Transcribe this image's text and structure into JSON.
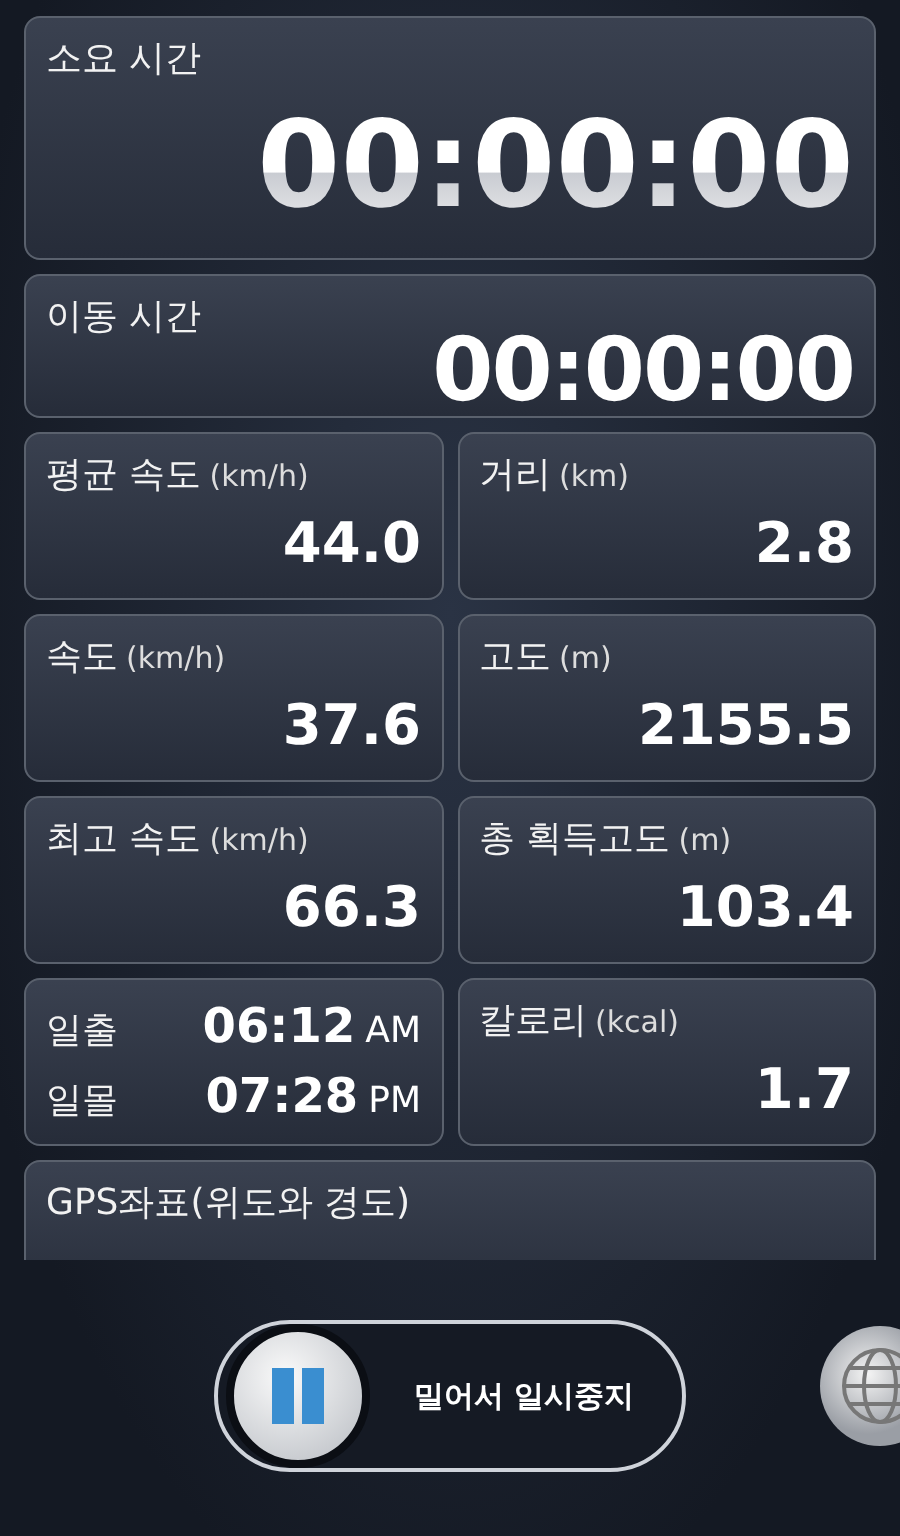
{
  "elapsed": {
    "label": "소요 시간",
    "value": "00:00:00"
  },
  "moving": {
    "label": "이동 시간",
    "value": "00:00:00"
  },
  "stats": [
    {
      "kind": "stat",
      "label": "평균 속도",
      "unit": "(km/h)",
      "value": "44.0"
    },
    {
      "kind": "stat",
      "label": "거리",
      "unit": "(km)",
      "value": "2.8"
    },
    {
      "kind": "stat",
      "label": "속도",
      "unit": "(km/h)",
      "value": "37.6"
    },
    {
      "kind": "stat",
      "label": "고도",
      "unit": "(m)",
      "value": "2155.5"
    },
    {
      "kind": "stat",
      "label": "최고 속도",
      "unit": "(km/h)",
      "value": "66.3"
    },
    {
      "kind": "stat",
      "label": "총 획득고도",
      "unit": "(m)",
      "value": "103.4"
    },
    {
      "kind": "sun",
      "rows": [
        {
          "label": "일출",
          "time": "06:12",
          "period": "AM"
        },
        {
          "label": "일몰",
          "time": "07:28",
          "period": "PM"
        }
      ]
    },
    {
      "kind": "stat",
      "label": "칼로리",
      "unit": "(kcal)",
      "value": "1.7"
    }
  ],
  "gps": {
    "label": "GPS좌표(위도와 경도)"
  },
  "pause_slider": {
    "label": "밀어서 일시중지",
    "level": 0
  }
}
